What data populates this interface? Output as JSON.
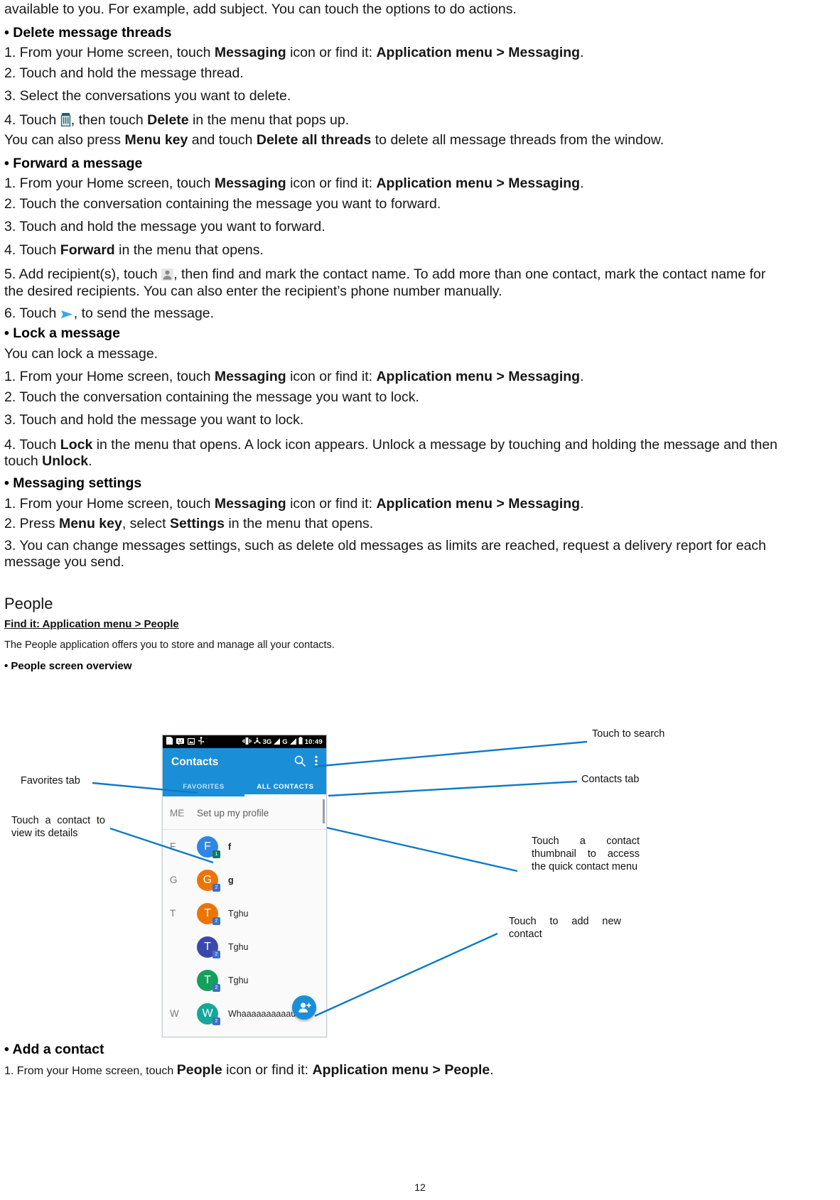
{
  "document": {
    "page_number": "12",
    "intro_line": "available to you. For example, add subject. You can touch the options to do actions.",
    "sections": [
      {
        "heading": "Delete message threads",
        "steps": [
          {
            "prefix": "1. From your Home screen, touch ",
            "bold1": "Messaging",
            "mid": " icon or find it: ",
            "bold2": "Application menu > Messaging",
            "suffix": "."
          },
          {
            "prefix": "2. Touch and hold the message thread.",
            "bold1": "",
            "mid": "",
            "bold2": "",
            "suffix": ""
          },
          {
            "prefix": "3. Select the conversations you want to delete.",
            "bold1": "",
            "mid": "",
            "bold2": "",
            "suffix": ""
          }
        ],
        "step4_a": "4. Touch ",
        "step4_icon": "trash-icon",
        "step4_b": ", then touch ",
        "step4_bold": "Delete",
        "step4_c": " in the menu that pops up.",
        "note_a": "You can also press ",
        "note_bold1": "Menu key",
        "note_b": " and touch ",
        "note_bold2": "Delete all threads",
        "note_c": " to delete all message threads from the window."
      },
      {
        "heading": "Forward a message",
        "steps": [
          {
            "prefix": "1. From your Home screen, touch ",
            "bold1": "Messaging",
            "mid": " icon or find it: ",
            "bold2": "Application menu > Messaging",
            "suffix": "."
          },
          {
            "prefix": "2. Touch the conversation containing the message you want to forward.",
            "bold1": "",
            "mid": "",
            "bold2": "",
            "suffix": ""
          },
          {
            "prefix": "3. Touch and hold the message you want to forward.",
            "bold1": "",
            "mid": "",
            "bold2": "",
            "suffix": ""
          }
        ],
        "step4_a": "4. Touch ",
        "step4_bold": "Forward",
        "step4_c": " in the menu that opens.",
        "step5_a": "5. Add recipient(s), touch ",
        "step5_icon": "person-icon",
        "step5_b": ", then find and mark the contact name. To add more than one contact, mark the contact name for the desired recipients. You can also enter the recipient’s phone number manually.",
        "step6_a": "6. Touch ",
        "step6_icon": "send-icon",
        "step6_b": ", to send the message."
      },
      {
        "heading": "Lock a message",
        "lead": "You can lock a message.",
        "steps": [
          {
            "prefix": "1. From your Home screen, touch ",
            "bold1": "Messaging",
            "mid": " icon or find it: ",
            "bold2": "Application menu > Messaging",
            "suffix": "."
          },
          {
            "prefix": "2. Touch the conversation containing the message you want to lock.",
            "bold1": "",
            "mid": "",
            "bold2": "",
            "suffix": ""
          },
          {
            "prefix": "3. Touch and hold the message you want to lock.",
            "bold1": "",
            "mid": "",
            "bold2": "",
            "suffix": ""
          }
        ],
        "step4_a": "4. Touch ",
        "step4_bold": "Lock",
        "step4_b": " in the menu that opens. A lock icon appears. Unlock a message by touching and holding the message and then touch ",
        "step4_bold2": "Unlock",
        "step4_c": "."
      },
      {
        "heading": "Messaging settings",
        "steps": [
          {
            "prefix": "1. From your Home screen, touch ",
            "bold1": "Messaging",
            "mid": " icon or find it: ",
            "bold2": "Application menu > Messaging",
            "suffix": "."
          },
          {
            "prefix": "2. Press ",
            "bold1": "Menu key",
            "mid": ", select ",
            "bold2": "Settings",
            "suffix": " in the menu that opens."
          }
        ],
        "step3": "3. You can change messages settings, such as delete old messages as limits are reached, request a delivery report for each message you send."
      }
    ],
    "people": {
      "title": "People",
      "find_it": "Find it: Application menu > People",
      "description": "The People application offers you to store and manage all your contacts.",
      "overview_heading": "People screen overview",
      "add_contact_heading": "Add a contact",
      "add_contact_step1_prefix": "1. From your Home screen, touch ",
      "add_contact_bold1": "People",
      "add_contact_mid": " icon or find it: ",
      "add_contact_bold2": "Application menu > People",
      "add_contact_suffix": "."
    }
  },
  "phone": {
    "status_bar": {
      "time": "10:49",
      "network": "3G",
      "network2": "G",
      "left_icons": [
        "sim-icon",
        "message-icon",
        "screenshot-icon",
        "usb-icon"
      ],
      "right_icons": [
        "vibrate-icon",
        "sync-icon",
        "signal-icon",
        "signal2-icon",
        "battery-icon"
      ]
    },
    "app_bar": {
      "title": "Contacts",
      "search_icon": "search-icon",
      "overflow_icon": "more-vert-icon"
    },
    "tabs": [
      {
        "label": "FAVORITES",
        "active": false
      },
      {
        "label": "ALL CONTACTS",
        "active": true
      }
    ],
    "me_row": {
      "index": "ME",
      "text": "Set up my profile"
    },
    "contacts": [
      {
        "index": "F",
        "initial": "F",
        "name": "f",
        "color": "#2f86e0",
        "badge_color": "#0f7b63",
        "badge": "1",
        "bold": true
      },
      {
        "index": "G",
        "initial": "G",
        "name": "g",
        "color": "#ee7402",
        "badge_color": "#3f6fc4",
        "badge": "2",
        "bold": true
      },
      {
        "index": "T",
        "initial": "T",
        "name": "Tghu",
        "color": "#ee7402",
        "badge_color": "#3f6fc4",
        "badge": "2",
        "bold": false
      },
      {
        "index": "",
        "initial": "T",
        "name": "Tghu",
        "color": "#3b48ab",
        "badge_color": "#3f6fc4",
        "badge": "2",
        "bold": false
      },
      {
        "index": "",
        "initial": "T",
        "name": "Tghu",
        "color": "#12a05c",
        "badge_color": "#3f6fc4",
        "badge": "2",
        "bold": false
      },
      {
        "index": "W",
        "initial": "W",
        "name": "Whaaaaaaaaaau",
        "color": "#15a79b",
        "badge_color": "#3f6fc4",
        "badge": "2",
        "bold": false
      }
    ],
    "fab_icon": "add-contact-icon",
    "accent_color": "#1a8fd8"
  },
  "callouts": {
    "search": "Touch to search",
    "contacts_tab": "Contacts tab",
    "favorites_tab": "Favorites tab",
    "view_details": "Touch a contact to view its details",
    "thumbnail": "Touch a contact thumbnail to access the quick contact menu",
    "add_new": "Touch to add new contact",
    "line_color": "#0d7ac4"
  }
}
